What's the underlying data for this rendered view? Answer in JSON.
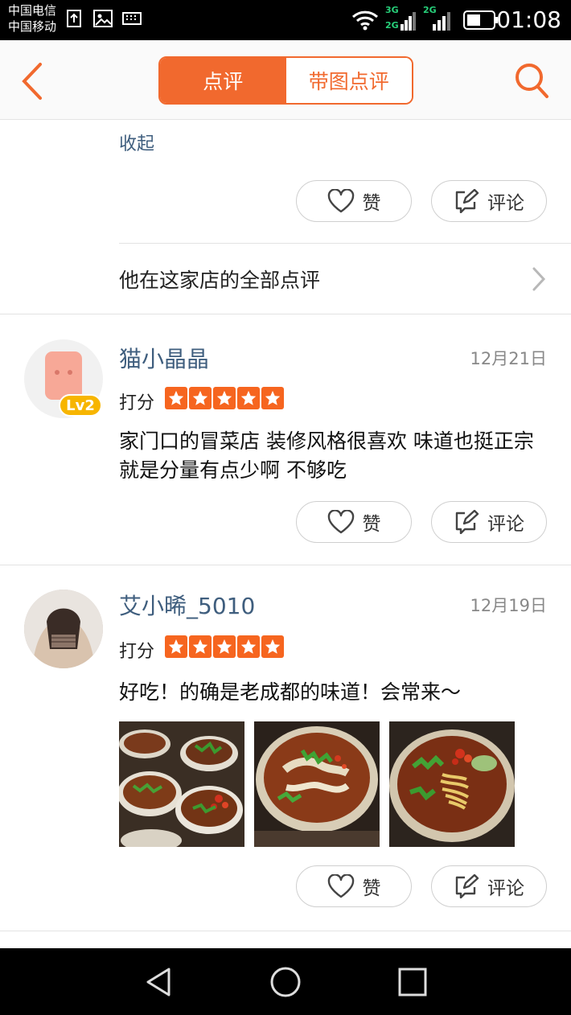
{
  "status_bar": {
    "carrier_1": "中国电信",
    "carrier_2": "中国移动",
    "net_top": "3G",
    "net_bottom": "2G",
    "net_2": "2G",
    "time": "01:08"
  },
  "header": {
    "back_icon": "chevron-left-icon",
    "tabs": [
      {
        "label": "点评",
        "active": true
      },
      {
        "label": "带图点评",
        "active": false
      }
    ],
    "search_icon": "search-icon",
    "accent_color": "#f1692e"
  },
  "previous_review": {
    "collapse_label": "收起",
    "like_label": "赞",
    "comment_label": "评论",
    "all_reviews_label": "他在这家店的全部点评"
  },
  "reviews": [
    {
      "username": "猫小晶晶",
      "level_badge": "Lv2",
      "date": "12月21日",
      "score_label": "打分",
      "stars": 5,
      "text": "家门口的冒菜店 装修风格很喜欢 味道也挺正宗 就是分量有点少啊 不够吃",
      "like_label": "赞",
      "comment_label": "评论"
    },
    {
      "username": "艾小晞_5010",
      "date": "12月19日",
      "score_label": "打分",
      "stars": 5,
      "text": "好吃！的确是老成都的味道！会常来～",
      "photos": [
        "food-photo-bowls",
        "food-photo-noodle-soup",
        "food-photo-noodles"
      ],
      "like_label": "赞",
      "comment_label": "评论"
    }
  ],
  "nav_bar": {
    "back_icon": "triangle-back-icon",
    "home_icon": "circle-home-icon",
    "recents_icon": "square-recents-icon"
  }
}
